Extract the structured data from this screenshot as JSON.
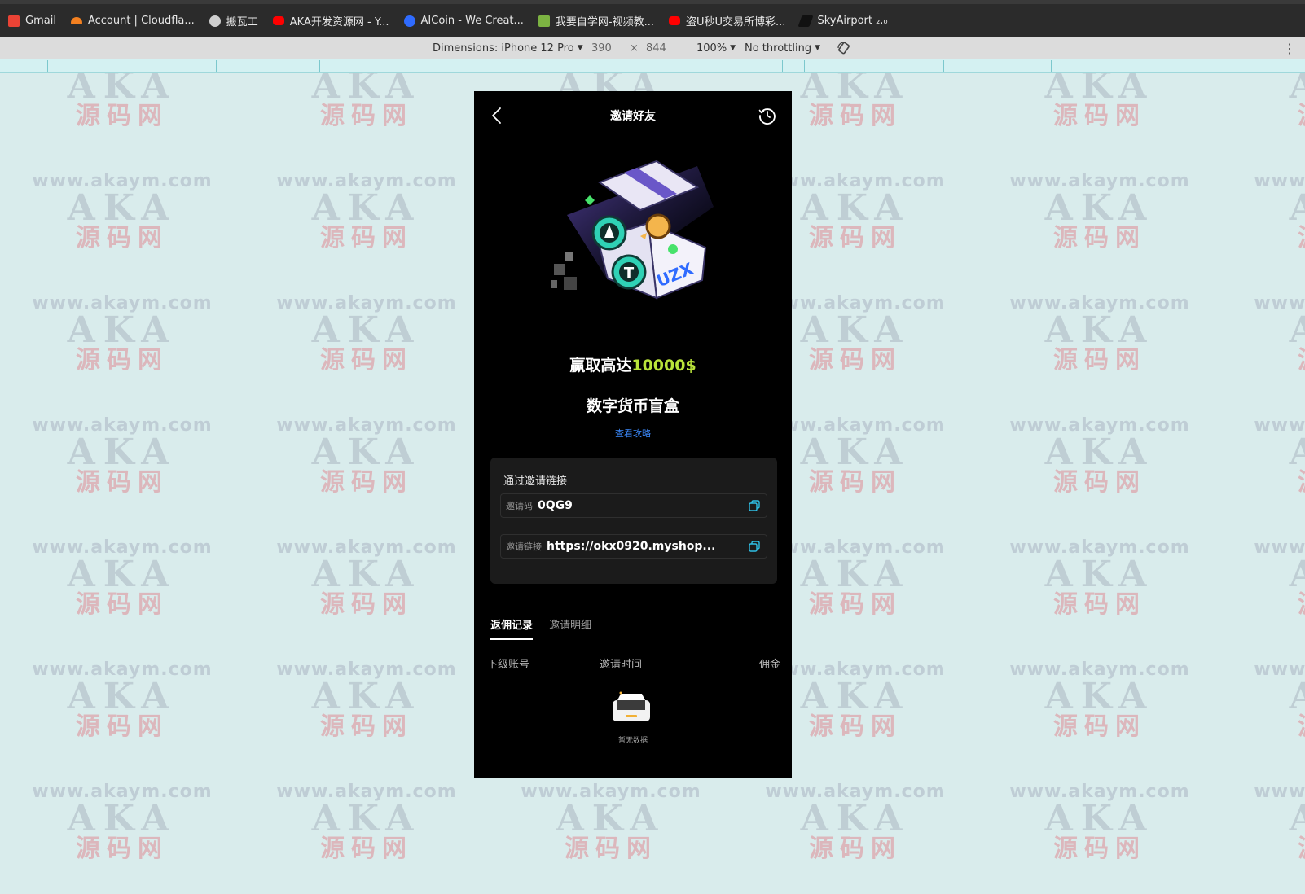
{
  "bookmarks": [
    {
      "label": "Gmail",
      "color": "#ea4335"
    },
    {
      "label": "Account | Cloudfla...",
      "color": "#f38020"
    },
    {
      "label": "搬瓦工",
      "color": "#cccccc"
    },
    {
      "label": "AKA开发资源网 - Y...",
      "color": "#ff0000"
    },
    {
      "label": "AICoin - We Creat...",
      "color": "#2f6bff"
    },
    {
      "label": "我要自学网-视频教...",
      "color": "#7cb342"
    },
    {
      "label": "盗U秒U交易所博彩...",
      "color": "#ff0000"
    },
    {
      "label": "SkyAirport ₂.₀",
      "color": "#222222"
    }
  ],
  "devtools": {
    "dimensions": "Dimensions: iPhone 12 Pro",
    "width": "390",
    "times": "×",
    "height": "844",
    "zoom": "100%",
    "throttle": "No throttling"
  },
  "watermark": {
    "url": "www.akaym.com",
    "brand": "AKA",
    "site": "源码网"
  },
  "app": {
    "title": "邀请好友",
    "headline_prefix": "赢取高达",
    "headline_amount": "10000$",
    "subhead": "数字货币盲盒",
    "guide_link": "查看攻略",
    "card_title": "通过邀请链接",
    "invite_code_label": "邀请码",
    "invite_code": "0QG9",
    "invite_link_label": "邀请链接",
    "invite_link": "https://okx0920.myshop...",
    "tabs": [
      "返佣记录",
      "邀请明细"
    ],
    "columns": [
      "下级账号",
      "邀请时间",
      "佣金"
    ],
    "empty": "暂无数据",
    "box_brand": "UZX"
  }
}
